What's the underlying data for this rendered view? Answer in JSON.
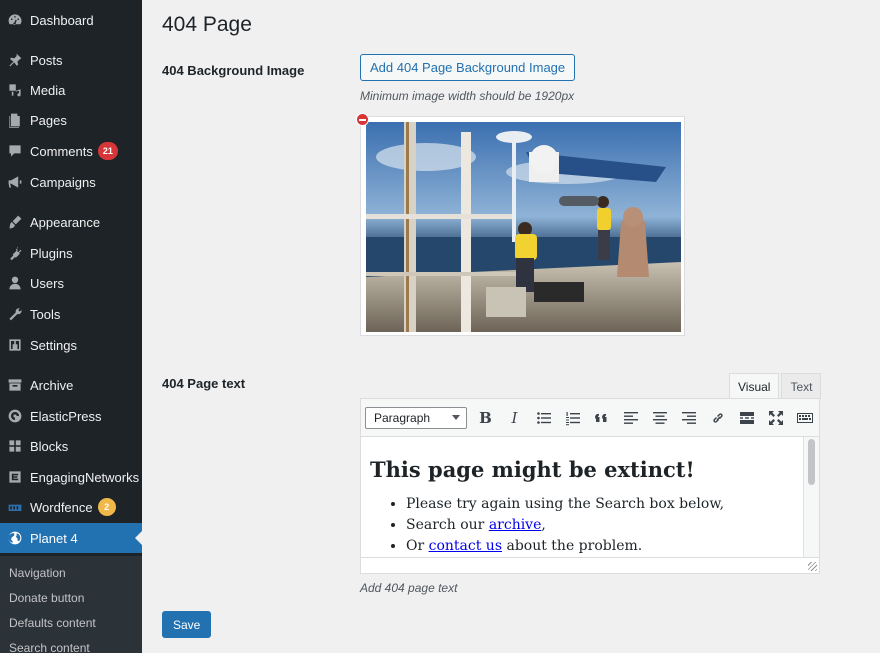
{
  "sidebar": {
    "items": [
      {
        "label": "Dashboard",
        "icon": "dashboard-icon"
      },
      {
        "label": "Posts",
        "icon": "pin-icon"
      },
      {
        "label": "Media",
        "icon": "media-icon"
      },
      {
        "label": "Pages",
        "icon": "pages-icon"
      },
      {
        "label": "Comments",
        "icon": "comment-icon",
        "badge": "21"
      },
      {
        "label": "Campaigns",
        "icon": "megaphone-icon"
      },
      {
        "label": "Appearance",
        "icon": "brush-icon"
      },
      {
        "label": "Plugins",
        "icon": "plug-icon"
      },
      {
        "label": "Users",
        "icon": "user-icon"
      },
      {
        "label": "Tools",
        "icon": "wrench-icon"
      },
      {
        "label": "Settings",
        "icon": "settings-icon"
      },
      {
        "label": "Archive",
        "icon": "archive-icon"
      },
      {
        "label": "ElasticPress",
        "icon": "elasticpress-icon"
      },
      {
        "label": "Blocks",
        "icon": "blocks-icon"
      },
      {
        "label": "EngagingNetworks",
        "icon": "engaging-networks-icon"
      },
      {
        "label": "Wordfence",
        "icon": "wordfence-icon",
        "badge": "2"
      },
      {
        "label": "Planet 4",
        "icon": "globe-icon"
      }
    ],
    "submenu": [
      "Navigation",
      "Donate button",
      "Defaults content",
      "Search content"
    ]
  },
  "page": {
    "title": "404 Page",
    "bg_image_label": "404 Background Image",
    "add_bg_button": "Add 404 Page Background Image",
    "min_width_note": "Minimum image width should be 1920px",
    "page_text_label": "404 Page text",
    "page_text_desc": "Add 404 page text",
    "save_button": "Save"
  },
  "editor": {
    "tabs": {
      "visual": "Visual",
      "text": "Text"
    },
    "format": "Paragraph",
    "heading": "This page might be extinct!",
    "li1": "Please try again using the Search box below,",
    "li2_prefix": "Search our ",
    "li2_link": "archive",
    "li2_suffix": ",",
    "li3_prefix": "Or ",
    "li3_link": "contact us",
    "li3_suffix": " about the problem."
  },
  "colors": {
    "sidebar_bg": "#1d2327",
    "accent": "#2271b1",
    "badge_red": "#d63638",
    "badge_orange": "#f0b849"
  }
}
